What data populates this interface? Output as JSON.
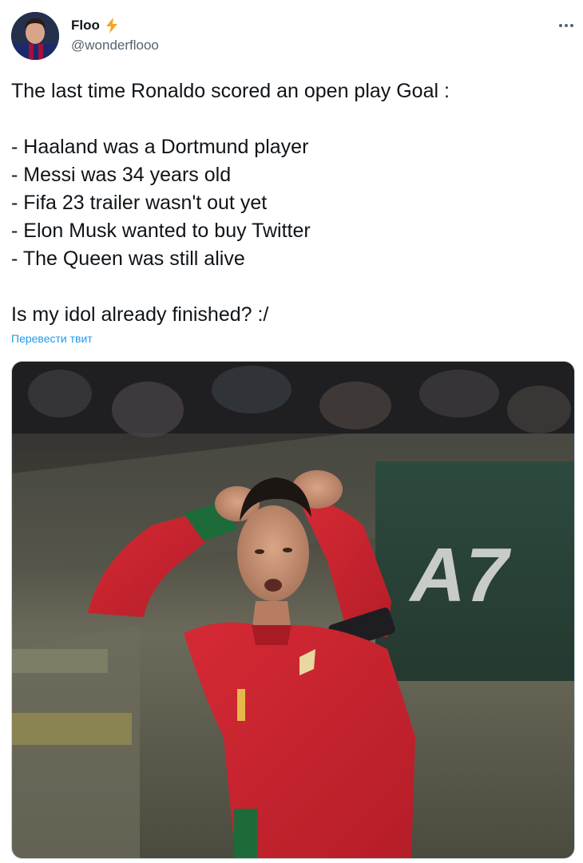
{
  "author": {
    "display_name": "Floo",
    "handle": "@wonderflooo",
    "badge_icon": "lightning-bolt-icon",
    "badge_color": "#f5a623"
  },
  "tweet": {
    "lines": [
      "The last time Ronaldo scored an open play Goal :",
      "",
      "- Haaland was a Dortmund player",
      "- Messi was 34 years old",
      "- Fifa 23 trailer wasn't out yet",
      "- Elon Musk wanted to buy Twitter",
      "- The Queen was still alive",
      "",
      "Is my idol already finished? :/"
    ],
    "translate_link": "Перевести твит"
  },
  "media": {
    "board_text": "A7",
    "description_icon": "photo-icon"
  },
  "colors": {
    "link": "#1d9bf0",
    "secondary_text": "#536471",
    "jersey_red": "#c8222c",
    "jersey_green": "#1e6b3a"
  }
}
